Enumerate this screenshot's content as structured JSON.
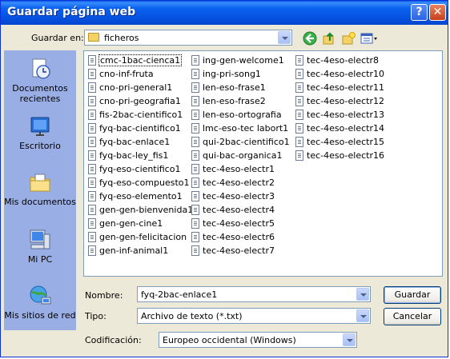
{
  "window": {
    "title": "Guardar página web",
    "help_label": "?",
    "close_label": "✕"
  },
  "location": {
    "label": "Guardar en:",
    "value": "ficheros"
  },
  "sidebar": {
    "items": [
      {
        "label": "Documentos recientes",
        "icon": "recent-documents-icon"
      },
      {
        "label": "Escritorio",
        "icon": "desktop-icon"
      },
      {
        "label": "Mis documentos",
        "icon": "my-documents-icon"
      },
      {
        "label": "Mi PC",
        "icon": "my-computer-icon"
      },
      {
        "label": "Mis sitios de red",
        "icon": "network-places-icon"
      }
    ]
  },
  "files": {
    "col1": [
      "cmc-1bac-cienca1",
      "cno-inf-fruta",
      "cno-pri-general1",
      "cno-pri-geografia1",
      "fis-2bac-cientifico1",
      "fyq-bac-cientifico1",
      "fyq-bac-enlace1",
      "fyq-bac-ley_fis1",
      "fyq-eso-cientifico1",
      "fyq-eso-compuesto1",
      "fyq-eso-elemento1",
      "gen-gen-bienvenida1",
      "gen-gen-cine1",
      "gen-gen-felicitacion",
      "gen-inf-animal1"
    ],
    "col2": [
      "ing-gen-welcome1",
      "ing-pri-song1",
      "len-eso-frase1",
      "len-eso-frase2",
      "len-eso-ortografia",
      "lmc-eso-tec labort1",
      "qui-2bac-cientifico1",
      "qui-bac-organica1",
      "tec-4eso-electr1",
      "tec-4eso-electr2",
      "tec-4eso-electr3",
      "tec-4eso-electr4",
      "tec-4eso-electr5",
      "tec-4eso-electr6",
      "tec-4eso-electr7"
    ],
    "col3": [
      "tec-4eso-electr8",
      "tec-4eso-electr10",
      "tec-4eso-electr11",
      "tec-4eso-electr12",
      "tec-4eso-electr13",
      "tec-4eso-electr14",
      "tec-4eso-electr15",
      "tec-4eso-electr16"
    ]
  },
  "form": {
    "name_label": "Nombre:",
    "name_value": "fyq-2bac-enlace1",
    "type_label": "Tipo:",
    "type_value": "Archivo de texto (*.txt)",
    "encoding_label": "Codificación:",
    "encoding_value": "Europeo occidental (Windows)"
  },
  "buttons": {
    "save": "Guardar",
    "cancel": "Cancelar"
  }
}
